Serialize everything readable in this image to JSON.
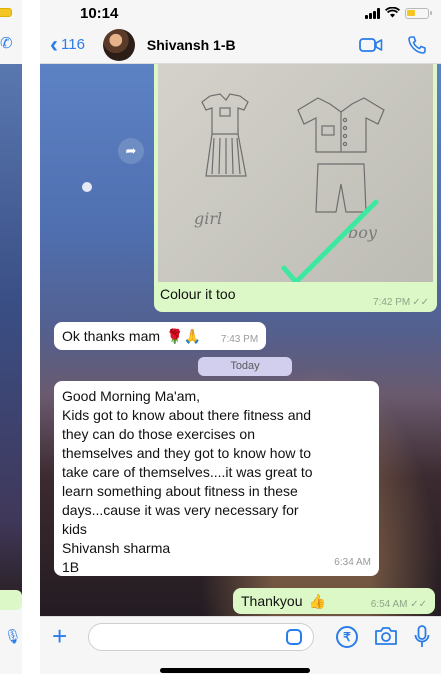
{
  "status_bar": {
    "time": "10:14"
  },
  "header": {
    "back_count": "116",
    "contact_name": "Shivansh 1-B"
  },
  "messages": {
    "image_caption": "Colour it too",
    "image_time": "7:42 PM",
    "image_handwriting_left": "girl",
    "image_handwriting_right": "boy",
    "ok_text": "Ok thanks mam",
    "ok_emoji": "🌹🙏",
    "ok_time": "7:43 PM",
    "day_divider": "Today",
    "long_lines": [
      "Good Morning Ma'am,",
      "Kids got to know about there fitness and",
      "they can do those exercises on",
      "themselves and they got to know how to",
      "take care  of themselves....it was great to",
      "learn something about fitness in these",
      "days...cause it was very necessary for",
      "kids",
      "Shivansh sharma",
      "1B"
    ],
    "long_time": "6:34 AM",
    "thank_text": "Thankyou",
    "thank_emoji": "👍",
    "thank_time": "6:54 AM"
  },
  "input": {
    "placeholder": ""
  },
  "icons": {
    "back": "chevron-left-icon",
    "video": "video-camera-icon",
    "call": "phone-icon",
    "forward": "forward-arrow-icon",
    "plus": "plus-icon",
    "sticker": "sticker-icon",
    "payment": "rupee-icon",
    "camera": "camera-icon",
    "mic": "microphone-icon"
  },
  "colors": {
    "accent": "#2b7de9",
    "outgoing_bubble": "#dcf8c6",
    "incoming_bubble": "#ffffff",
    "day_pill": "#d2ceee"
  }
}
